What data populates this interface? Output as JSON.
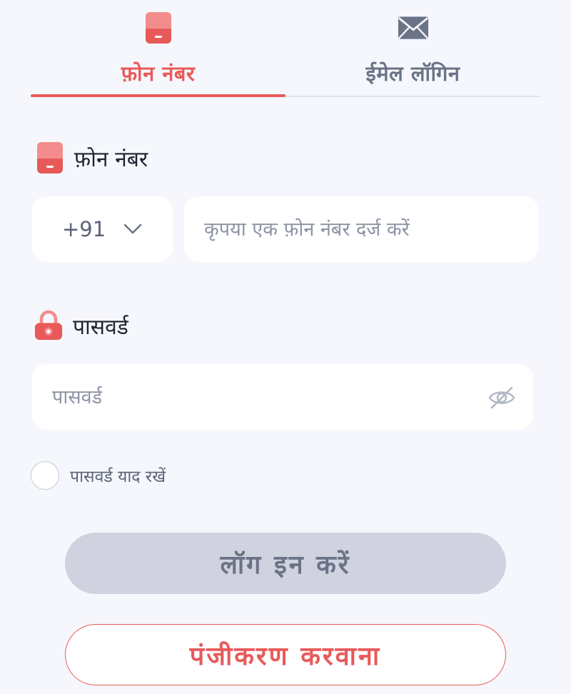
{
  "tabs": [
    {
      "label": "फ़ोन नंबर",
      "icon": "phone-icon",
      "active": true
    },
    {
      "label": "ईमेल लॉगिन",
      "icon": "mail-icon",
      "active": false
    }
  ],
  "phone": {
    "label": "फ़ोन नंबर",
    "icon": "phone-icon",
    "country_code": "+91",
    "placeholder": "कृपया एक फ़ोन नंबर दर्ज करें"
  },
  "password": {
    "label": "पासवर्ड",
    "icon": "lock-icon",
    "placeholder": "पासवर्ड",
    "toggle_icon": "eye-off-icon"
  },
  "remember": {
    "label": "पासवर्ड याद रखें",
    "checked": false
  },
  "buttons": {
    "login": "लॉग इन करें",
    "register": "पंजीकरण करवाना"
  },
  "colors": {
    "accent": "#e85a5a",
    "background": "#f6f7fc",
    "disabled_button": "#d0d3df"
  }
}
